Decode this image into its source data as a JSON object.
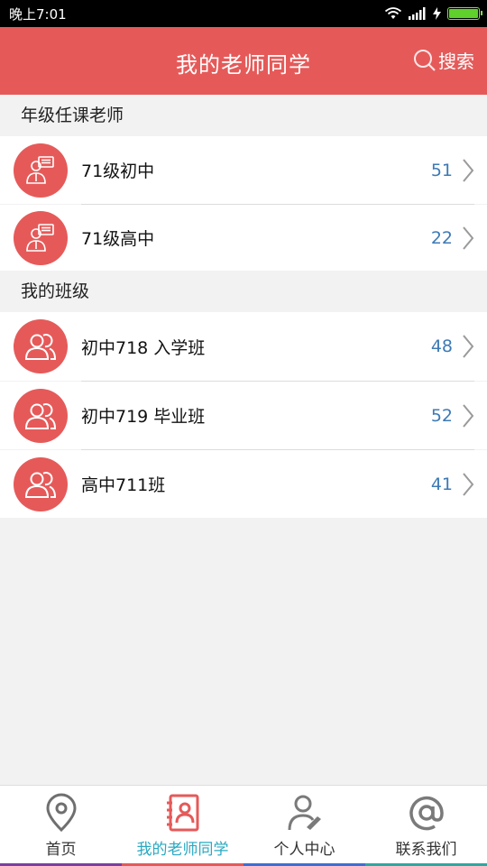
{
  "status": {
    "time": "晚上7:01"
  },
  "header": {
    "title": "我的老师同学",
    "search_label": "搜索"
  },
  "sections": {
    "teachers": {
      "label": "年级任课老师",
      "items": [
        {
          "label": "71级初中",
          "count": "51",
          "icon": "teacher-icon"
        },
        {
          "label": "71级高中",
          "count": "22",
          "icon": "teacher-icon"
        }
      ]
    },
    "classes": {
      "label": "我的班级",
      "items": [
        {
          "label": "初中718 入学班",
          "count": "48",
          "icon": "group-icon"
        },
        {
          "label": "初中719 毕业班",
          "count": "52",
          "icon": "group-icon"
        },
        {
          "label": "高中711班",
          "count": "41",
          "icon": "group-icon"
        }
      ]
    }
  },
  "tabbar": {
    "tabs": [
      {
        "label": "首页",
        "icon": "location-pin-icon",
        "active": false
      },
      {
        "label": "我的老师同学",
        "icon": "contacts-book-icon",
        "active": true
      },
      {
        "label": "个人中心",
        "icon": "user-edit-icon",
        "active": false
      },
      {
        "label": "联系我们",
        "icon": "at-sign-icon",
        "active": false
      }
    ]
  },
  "colors": {
    "accent": "#e55a59",
    "active_tab": "#2aa9c2",
    "count": "#3d7ab5"
  }
}
